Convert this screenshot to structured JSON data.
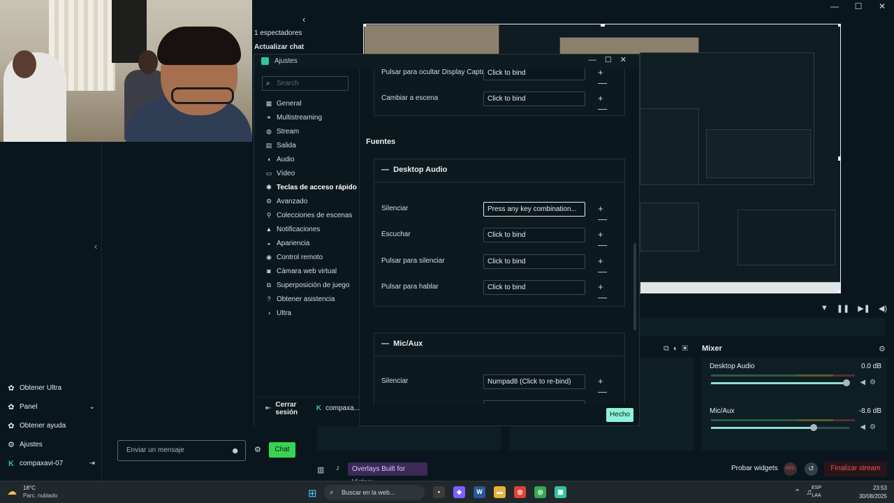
{
  "window": {
    "minimize": "—",
    "maximize": "☐",
    "close": "✕"
  },
  "chat_header": {
    "viewers": "1 espectadores",
    "refresh": "Actualizar chat"
  },
  "left_sidebar": [
    {
      "icon": "gear-plus-icon",
      "glyph": "✿",
      "label": "Obtener Ultra"
    },
    {
      "icon": "dashboard-icon",
      "glyph": "✿",
      "label": "Panel",
      "chevron": "⌄"
    },
    {
      "icon": "help-icon",
      "glyph": "✿",
      "label": "Obtener ayuda"
    },
    {
      "icon": "gear-icon",
      "glyph": "⚙",
      "label": "Ajustes"
    },
    {
      "icon": "streamlabs-logo-icon",
      "glyph": "K",
      "label": "compaxavi-07",
      "tail": "⇥"
    }
  ],
  "chat": {
    "placeholder": "Enviar un mensaje",
    "send_label": "Chat"
  },
  "modal": {
    "title": "Ajustes",
    "search_placeholder": "Search",
    "nav": [
      {
        "icon": "grid-icon",
        "glyph": "▦",
        "label": "General"
      },
      {
        "icon": "multistream-icon",
        "glyph": "⚭",
        "label": "Multistreaming"
      },
      {
        "icon": "globe-icon",
        "glyph": "◍",
        "label": "Stream"
      },
      {
        "icon": "output-icon",
        "glyph": "▤",
        "label": "Salida"
      },
      {
        "icon": "audio-icon",
        "glyph": "◖",
        "label": "Audio"
      },
      {
        "icon": "video-icon",
        "glyph": "▭",
        "label": "Vídeo"
      },
      {
        "icon": "hotkeys-icon",
        "glyph": "✱",
        "label": "Teclas de acceso rápido",
        "active": true
      },
      {
        "icon": "advanced-icon",
        "glyph": "⚙",
        "label": "Avanzado"
      },
      {
        "icon": "collections-icon",
        "glyph": "⚲",
        "label": "Colecciones de escenas"
      },
      {
        "icon": "bell-icon",
        "glyph": "▲",
        "label": "Notificaciones"
      },
      {
        "icon": "appearance-icon",
        "glyph": "◒",
        "label": "Apariencia"
      },
      {
        "icon": "remote-icon",
        "glyph": "◉",
        "label": "Control remoto"
      },
      {
        "icon": "camera-icon",
        "glyph": "◙",
        "label": "Cámara web virtual"
      },
      {
        "icon": "game-overlay-icon",
        "glyph": "⧉",
        "label": "Superposición de juego"
      },
      {
        "icon": "help-circle-icon",
        "glyph": "?",
        "label": "Obtener asistencia"
      },
      {
        "icon": "ultra-icon",
        "glyph": "◑",
        "label": "Ultra"
      }
    ],
    "logout": "Cerrar sesión",
    "account": "compaxa...",
    "top_rows": [
      {
        "label": "Pulsar para ocultar Display Capture",
        "value": "Click to bind"
      },
      {
        "label": "Cambiar a escena",
        "value": "Click to bind"
      }
    ],
    "sources_heading": "Fuentes",
    "desktop_audio": {
      "title": "Desktop Audio",
      "collapse": "—",
      "rows": [
        {
          "label": "Silenciar",
          "value": "Press any key combination...",
          "focus": true
        },
        {
          "label": "Escuchar",
          "value": "Click to bind"
        },
        {
          "label": "Pulsar para silenciar",
          "value": "Click to bind"
        },
        {
          "label": "Pulsar para hablar",
          "value": "Click to bind"
        }
      ]
    },
    "mic_aux": {
      "title": "Mic/Aux",
      "collapse": "—",
      "rows": [
        {
          "label": "Silenciar",
          "value": "Numpad8 (Click to re-bind)"
        }
      ]
    },
    "add_remove": "+ —",
    "done_label": "Hecho"
  },
  "mixer": {
    "title": "Mixer",
    "channels": [
      {
        "name": "Desktop Audio",
        "db": "0.0 dB",
        "level": 0.98
      },
      {
        "name": "Mic/Aux",
        "db": "-8.6 dB",
        "level": 0.74
      }
    ]
  },
  "bottom_bar": {
    "promo": "Overlays Built for Victory",
    "test_widgets": "Probar widgets",
    "rec": "REC",
    "end_stream": "Finalizar stream"
  },
  "taskbar": {
    "temperature": "18°C",
    "weather": "Parc. nublado",
    "search_placeholder": "Buscar en la web...",
    "lang_1": "ESP",
    "lang_2": "LAA",
    "time": "23:53",
    "date": "30/08/2025"
  },
  "colors": {
    "accent": "#31c3a2",
    "done": "#8ff2d8",
    "chat_button": "#39d353",
    "end_stream": "#f15454"
  }
}
